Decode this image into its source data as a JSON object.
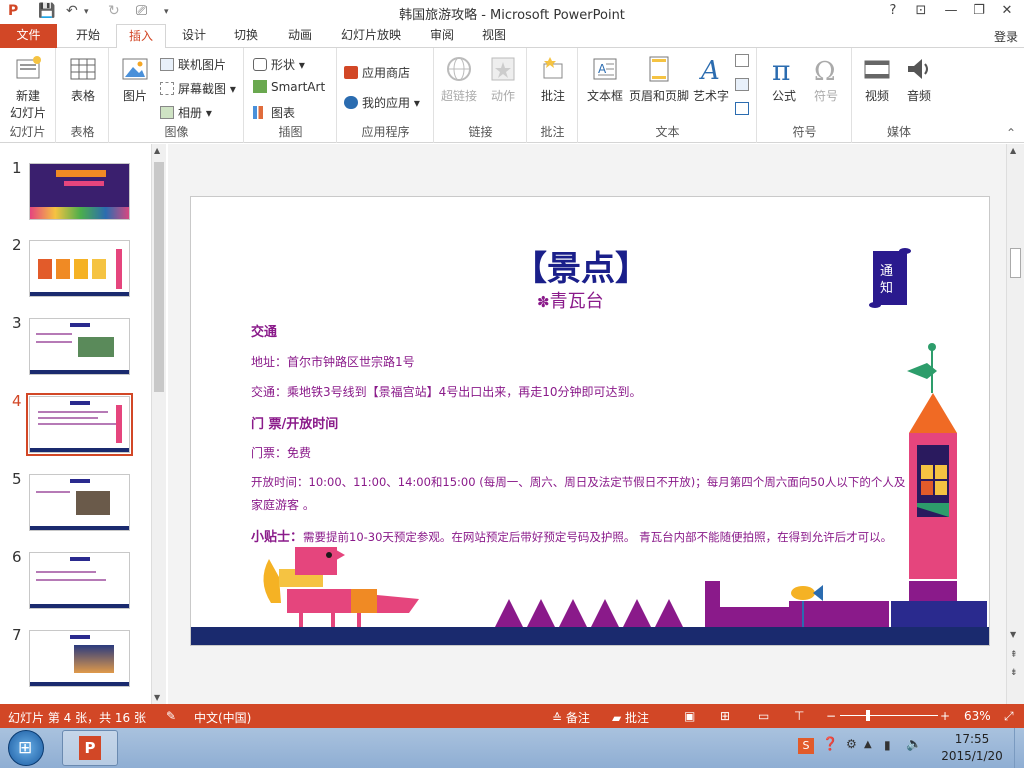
{
  "window": {
    "title": "韩国旅游攻略 - Microsoft PowerPoint",
    "help": "?",
    "restore_ribbon": "⊡",
    "minimize": "—",
    "maximize": "❐",
    "close": "✕"
  },
  "tabs": [
    "文件",
    "开始",
    "插入",
    "设计",
    "切换",
    "动画",
    "幻灯片放映",
    "审阅",
    "视图"
  ],
  "active_tab": "插入",
  "login": "登录",
  "ribbon": {
    "slides_group": {
      "label": "幻灯片",
      "new_slide": "新建",
      "new_slide2": "幻灯片"
    },
    "tables_group": {
      "label": "表格",
      "table": "表格"
    },
    "images_group": {
      "label": "图像",
      "picture": "图片",
      "online_pictures": "联机图片",
      "screenshot": "屏幕截图",
      "album": "相册"
    },
    "illustrations_group": {
      "label": "插图",
      "shapes": "形状",
      "smartart": "SmartArt",
      "chart": "图表"
    },
    "apps_group": {
      "label": "应用程序",
      "store": "应用商店",
      "my_apps": "我的应用"
    },
    "links_group": {
      "label": "链接",
      "hyperlink": "超链接",
      "action": "动作"
    },
    "comments_group": {
      "label": "批注",
      "comment": "批注"
    },
    "text_group": {
      "label": "文本",
      "textbox": "文本框",
      "header_footer": "页眉和页脚",
      "wordart": "艺术字"
    },
    "symbols_group": {
      "label": "符号",
      "equation": "公式",
      "symbol": "符号"
    },
    "media_group": {
      "label": "媒体",
      "video": "视频",
      "audio": "音频"
    }
  },
  "thumbnails": [
    {
      "num": "1"
    },
    {
      "num": "2"
    },
    {
      "num": "3"
    },
    {
      "num": "4",
      "selected": true
    },
    {
      "num": "5"
    },
    {
      "num": "6"
    },
    {
      "num": "7"
    }
  ],
  "slide": {
    "title": "【景点】",
    "subtitle": "青瓦台",
    "notice": "通知",
    "heading_transport": "交通",
    "address": "地址：首尔市钟路区世宗路1号",
    "transport": "交通：乘地铁3号线到【景福宫站】4号出口出来，再走10分钟即可达到。",
    "heading_tickets": "门 票/开放时间",
    "tickets": "门票：免费",
    "hours_line1": "开放时间：10:00、11:00、14:00和15:00 (每周一、周六、周日及法定节假日不开放)；每月第四个周六面向50人以下的个人及",
    "hours_line2": "家庭游客 。",
    "tip_label": "小贴士：",
    "tip": "需要提前10-30天预定参观。在网站预定后带好预定号码及护照。 青瓦台内部不能随便拍照，在得到允许后才可以。"
  },
  "status": {
    "slide_info": "幻灯片 第 4 张，共 16 张",
    "language": "中文(中国)",
    "notes": "备注",
    "comments": "批注",
    "zoom": "63%"
  },
  "taskbar": {
    "time": "17:55",
    "date": "2015/1/20"
  },
  "colors": {
    "accent": "#d24726",
    "slide_text": "#8a1a8a",
    "title": "#1a1f8a"
  }
}
